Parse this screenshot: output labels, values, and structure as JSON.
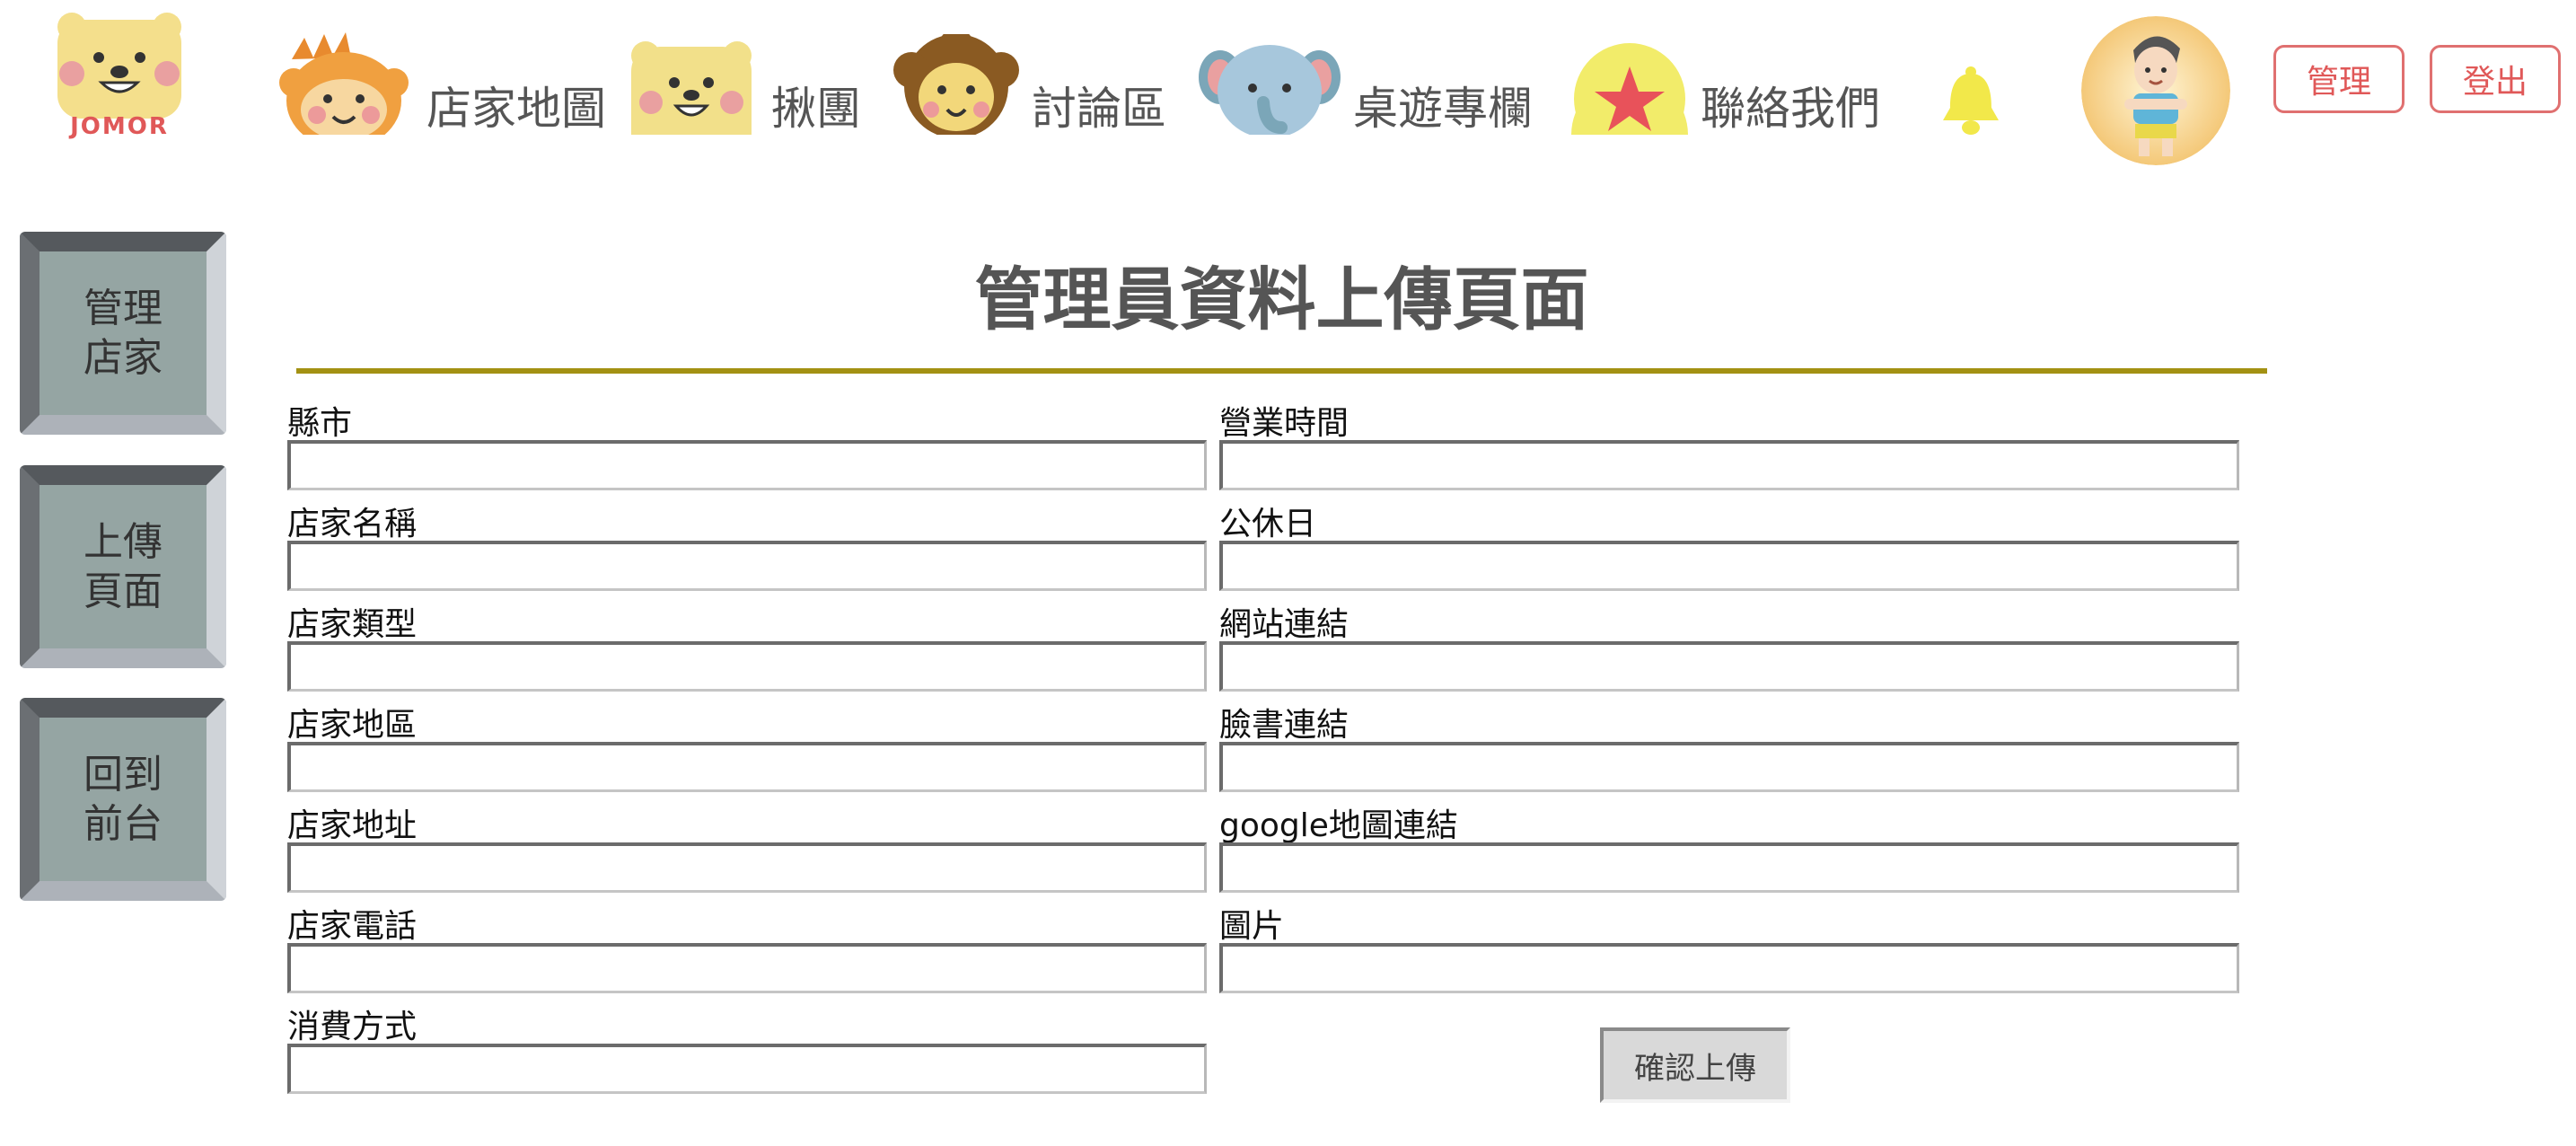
{
  "header": {
    "logo_text": "JOMOR",
    "nav": [
      {
        "label": "店家地圖",
        "icon": "monkey-icon"
      },
      {
        "label": "揪團",
        "icon": "bear-icon"
      },
      {
        "label": "討論區",
        "icon": "lion-icon"
      },
      {
        "label": "桌遊專欄",
        "icon": "elephant-icon"
      },
      {
        "label": "聯絡我們",
        "icon": "star-icon"
      }
    ],
    "admin_label": "管理",
    "logout_label": "登出"
  },
  "sidebar": {
    "items": [
      {
        "label": "管理\n店家"
      },
      {
        "label": "上傳\n頁面"
      },
      {
        "label": "回到\n前台"
      }
    ]
  },
  "main": {
    "title": "管理員資料上傳頁面",
    "left_fields": [
      {
        "label": "縣市",
        "value": ""
      },
      {
        "label": "店家名稱",
        "value": ""
      },
      {
        "label": "店家類型",
        "value": ""
      },
      {
        "label": "店家地區",
        "value": ""
      },
      {
        "label": "店家地址",
        "value": ""
      },
      {
        "label": "店家電話",
        "value": ""
      },
      {
        "label": "消費方式",
        "value": ""
      }
    ],
    "right_fields": [
      {
        "label": "營業時間",
        "value": ""
      },
      {
        "label": "公休日",
        "value": ""
      },
      {
        "label": "網站連結",
        "value": ""
      },
      {
        "label": "臉書連結",
        "value": ""
      },
      {
        "label": "google地圖連結",
        "value": ""
      },
      {
        "label": "圖片",
        "value": ""
      }
    ],
    "submit_label": "確認上傳"
  },
  "colors": {
    "accent_red": "#e05858",
    "divider_olive": "#a39113",
    "bell_yellow": "#f2e86a",
    "sidebar_gray": "#95a5a3"
  }
}
